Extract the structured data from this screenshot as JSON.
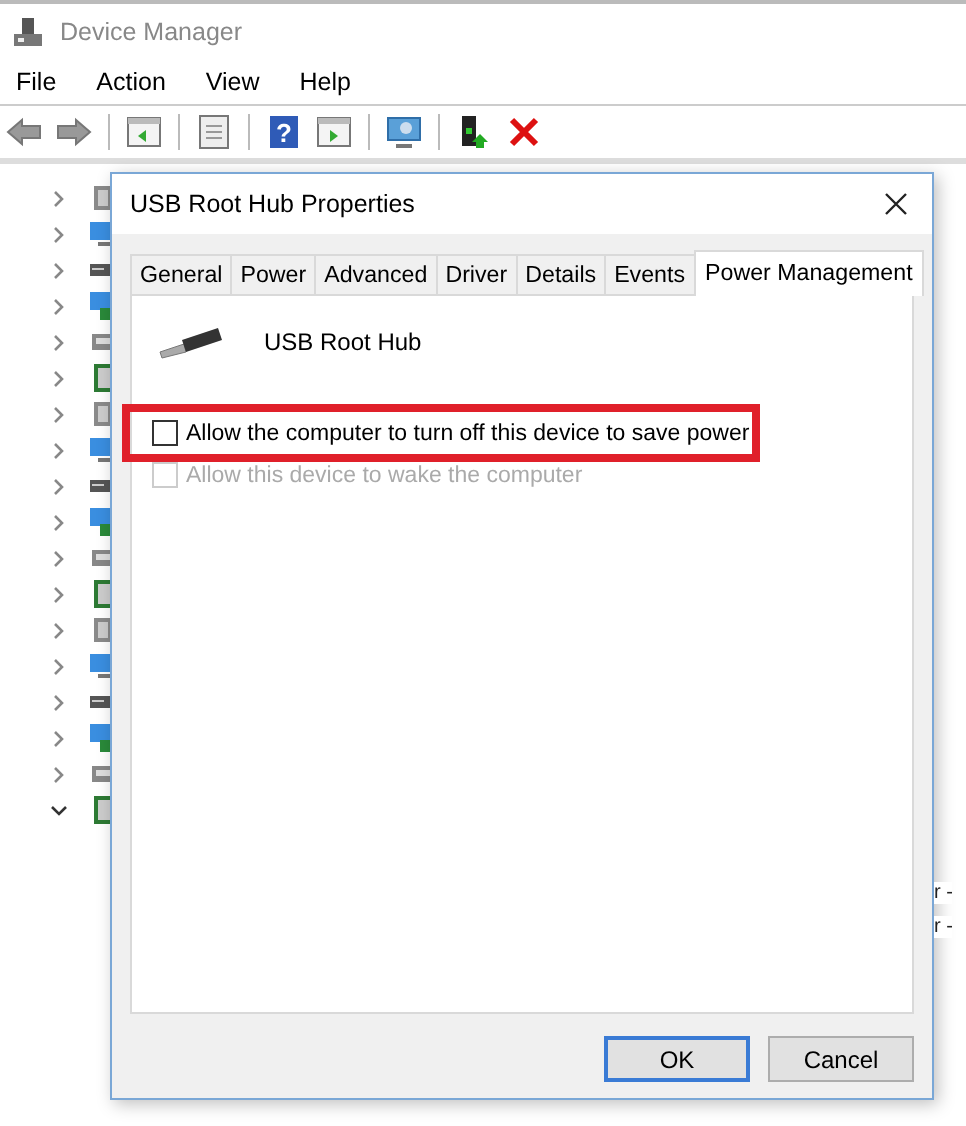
{
  "window": {
    "title": "Device Manager"
  },
  "menu": [
    "File",
    "Action",
    "View",
    "Help"
  ],
  "toolbar": {
    "help_glyph": "?"
  },
  "tree": {
    "items": [
      {
        "expanded": false
      },
      {
        "expanded": false
      },
      {
        "expanded": false
      },
      {
        "expanded": false
      },
      {
        "expanded": false
      },
      {
        "expanded": false
      },
      {
        "expanded": false
      },
      {
        "expanded": false
      },
      {
        "expanded": false
      },
      {
        "expanded": false
      },
      {
        "expanded": false
      },
      {
        "expanded": false
      },
      {
        "expanded": false
      },
      {
        "expanded": false
      },
      {
        "expanded": false
      },
      {
        "expanded": false
      },
      {
        "expanded": false
      },
      {
        "expanded": true
      }
    ],
    "partial_texts": [
      "r -",
      "r -"
    ]
  },
  "dialog": {
    "title": "USB Root Hub Properties",
    "tabs": [
      {
        "label": "General",
        "selected": false
      },
      {
        "label": "Power",
        "selected": false
      },
      {
        "label": "Advanced",
        "selected": false
      },
      {
        "label": "Driver",
        "selected": false
      },
      {
        "label": "Details",
        "selected": false
      },
      {
        "label": "Events",
        "selected": false
      },
      {
        "label": "Power Management",
        "selected": true
      }
    ],
    "device_name": "USB Root Hub",
    "options": [
      {
        "label": "Allow the computer to turn off this device to save power",
        "checked": false,
        "disabled": false,
        "highlighted": true
      },
      {
        "label": "Allow this device to wake the computer",
        "checked": false,
        "disabled": true,
        "highlighted": false
      }
    ],
    "buttons": [
      {
        "label": "OK",
        "default": true
      },
      {
        "label": "Cancel",
        "default": false
      }
    ]
  }
}
